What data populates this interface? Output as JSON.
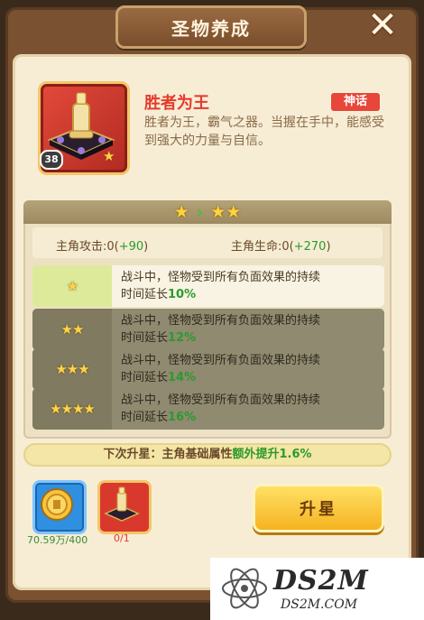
{
  "window": {
    "title": "圣物养成",
    "close_glyph": "✕"
  },
  "relic": {
    "name": "胜者为王",
    "level": "38",
    "rarity": "神话",
    "description": "胜者为王，霸气之器。当握在手中，能感受到强大的力量与自信。"
  },
  "star_transition": {
    "from": "★",
    "arrow": "›",
    "to": "★★"
  },
  "stats": {
    "attack_label": "主角攻击:0(",
    "attack_inc": "+90",
    "attack_close": ")",
    "hp_label": "主角生命:0(",
    "hp_inc": "+270",
    "hp_close": ")"
  },
  "effects": [
    {
      "stars": "★",
      "line1": "战斗中，怪物受到所有负面效果的持续",
      "line2": "时间延长",
      "pct": "10%"
    },
    {
      "stars": "★★",
      "line1": "战斗中，怪物受到所有负面效果的持续",
      "line2": "时间延长",
      "pct": "12%"
    },
    {
      "stars": "★★★",
      "line1": "战斗中，怪物受到所有负面效果的持续",
      "line2": "时间延长",
      "pct": "14%"
    },
    {
      "stars": "★★★★",
      "line1": "战斗中，怪物受到所有负面效果的持续",
      "line2": "时间延长",
      "pct": "16%"
    }
  ],
  "next_star": {
    "prefix": "下次升星：主角基础属性",
    "bonus": "额外提升1.6%"
  },
  "costs": {
    "coins": "70.59万/400",
    "relic": "0/1"
  },
  "upgrade_button": "升星",
  "watermark": {
    "main": "DS2M",
    "sub": "DS2M.COM"
  },
  "colors": {
    "accent_red": "#e53a2c",
    "increase_green": "#2c9a2c",
    "button_gold": "#f5b320"
  }
}
